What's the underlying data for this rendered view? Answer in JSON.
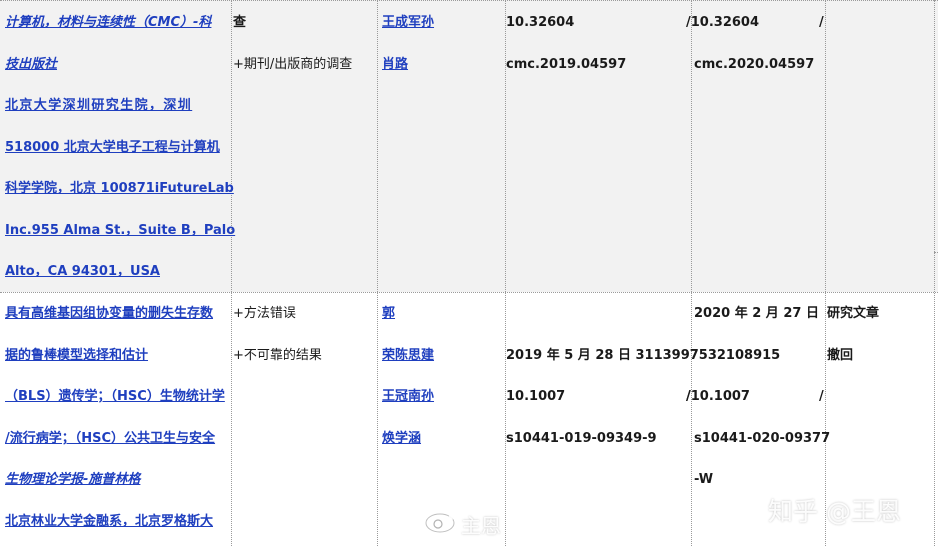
{
  "row1": {
    "col1": [
      "计算机，材料与连续性（CMC）-科",
      "技出版社",
      "北京大学深圳研究生院，深圳",
      "518000 北京大学电子工程与计算机",
      "科学学院，北京 100871iFutureLab",
      "Inc.955 Alma St.，Suite B，Palo",
      "Alto，CA 94301，USA"
    ],
    "col2": [
      "查",
      "+期刊/出版商的调查"
    ],
    "col3": [
      "王成军孙",
      "肖路"
    ],
    "col4": [
      "10.32604",
      "cmc.2019.04597"
    ],
    "col5": [
      "/10.32604",
      "cmc.2020.04597"
    ],
    "col5_tail": "/"
  },
  "row2": {
    "col1": [
      "具有高维基因组协变量的删失生存数",
      "据的鲁棒模型选择和估计",
      "（BLS）遗传学；（HSC）生物统计学",
      "/流行病学；（HSC）公共卫生与安全",
      "生物理论学报-施普林格",
      "北京林业大学金融系，北京罗格斯大"
    ],
    "col2": [
      "+方法错误",
      "+不可靠的结果"
    ],
    "col3": [
      "郭",
      "荣陈思建",
      "王冠南孙",
      "焕学涵"
    ],
    "col4": [
      "2019 年 5 月 28 日 3113997532108915",
      "10.1007",
      "s10441-019-09349-9"
    ],
    "col4_tail": "/",
    "col5": [
      "2020 年 2 月 27 日",
      "/10.1007",
      "s10441-020-09377",
      "-W"
    ],
    "col5_tail": "/",
    "col6": [
      "研究文章",
      "撤回"
    ]
  },
  "watermark": {
    "zhihu": "知乎 @王恩",
    "weibo": "主恩"
  }
}
